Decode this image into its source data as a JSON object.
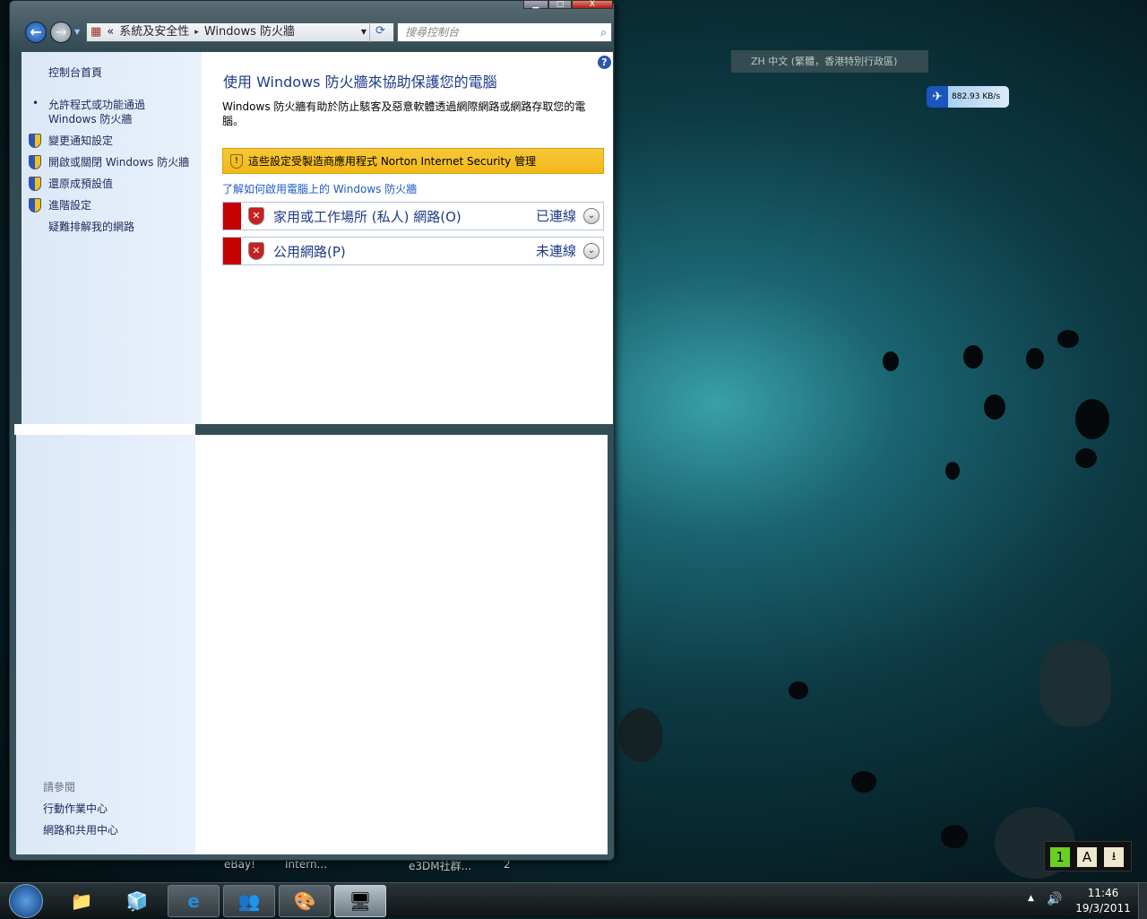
{
  "window": {
    "controls": {
      "minimize": "▁",
      "maximize": "□",
      "close": "X"
    },
    "breadcrumb": {
      "prefix": "«",
      "parent": "系統及安全性",
      "separator": "▸",
      "current": "Windows 防火牆"
    },
    "search_placeholder": "搜尋控制台",
    "help": "?"
  },
  "sidebar": {
    "home": "控制台首頁",
    "items": [
      {
        "label": "允許程式或功能通過 Windows 防火牆",
        "icon": "bullet"
      },
      {
        "label": "變更通知設定",
        "icon": "uac-shield"
      },
      {
        "label": "開啟或關閉 Windows 防火牆",
        "icon": "uac-shield"
      },
      {
        "label": "還原成預設值",
        "icon": "uac-shield"
      },
      {
        "label": "進階設定",
        "icon": "uac-shield"
      },
      {
        "label": "疑難排解我的網路",
        "icon": "none"
      }
    ],
    "see_also": {
      "title": "請參閱",
      "links": [
        "行動作業中心",
        "網路和共用中心"
      ]
    }
  },
  "main": {
    "title": "使用 Windows 防火牆來協助保護您的電腦",
    "description": "Windows 防火牆有助於防止駭客及惡意軟體透過網際網路或網路存取您的電腦。",
    "warning": "這些設定受製造商應用程式 Norton Internet Security 管理",
    "learn_link": "了解如何啟用電腦上的 Windows 防火牆",
    "networks": [
      {
        "name": "家用或工作場所 (私人) 網路(O)",
        "status": "已連線"
      },
      {
        "name": "公用網路(P)",
        "status": "未連線"
      }
    ]
  },
  "desktop": {
    "language_bar": "ZH 中文 (繁體，香港特別行政區)",
    "speed_widget": "882.93 KB/s",
    "icon_labels": [
      "eBay!",
      "Intern...",
      "e3DM社群...",
      "2"
    ],
    "ime_buttons": [
      "1",
      "A",
      "⭳"
    ]
  },
  "taskbar": {
    "time": "11:46",
    "date": "19/3/2011"
  },
  "colors": {
    "warning_bg": "#f6c232",
    "link": "#1f5bc6",
    "error_red": "#c40000"
  }
}
